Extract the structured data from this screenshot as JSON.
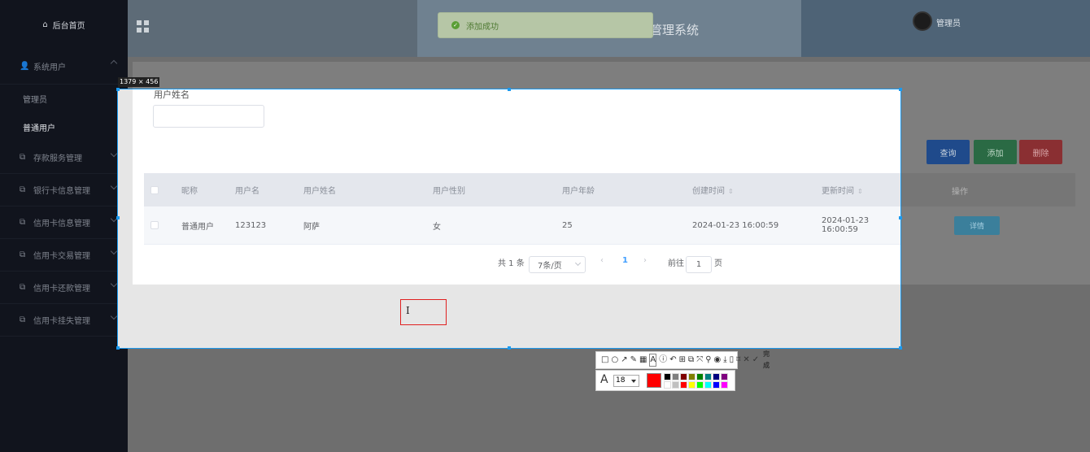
{
  "sidebar": {
    "brand": "后台首页",
    "groups": [
      {
        "label": "系统用户",
        "expanded": true
      },
      {
        "label": "存款服务管理"
      },
      {
        "label": "银行卡信息管理"
      },
      {
        "label": "信用卡信息管理"
      },
      {
        "label": "信用卡交易管理"
      },
      {
        "label": "信用卡还款管理"
      },
      {
        "label": "信用卡挂失管理"
      }
    ],
    "sub_items": [
      "管理员",
      "普通用户"
    ]
  },
  "header": {
    "title_fragment": "管理系统",
    "user": "管理员"
  },
  "toast": {
    "message": "添加成功",
    "color": "#5a9e35"
  },
  "search": {
    "label": "用户姓名",
    "value": ""
  },
  "actions": {
    "query": "查询",
    "add": "添加",
    "delete": "删除"
  },
  "table": {
    "columns": [
      "昵称",
      "用户名",
      "用户姓名",
      "用户性别",
      "用户年龄",
      "创建时间",
      "更新时间",
      "操作"
    ],
    "rows": [
      {
        "nickname": "普通用户",
        "username": "123123",
        "name": "阿萨",
        "gender": "女",
        "age": "25",
        "created": "2024-01-23 16:00:59",
        "updated": "2024-01-23 16:00:59",
        "action": "详情"
      }
    ]
  },
  "pagination": {
    "total": "共 1 条",
    "page_size": "7条/页",
    "current": "1",
    "goto_label": "前往",
    "goto_value": "1",
    "page_suffix": "页",
    "prev": "‹",
    "next": "›"
  },
  "screenshot_tool": {
    "dimensions": "1379 × 456",
    "font_size": "18",
    "done_label": "完成",
    "current_color": "#ff0000",
    "palette": [
      "#000000",
      "#808080",
      "#800000",
      "#808000",
      "#008000",
      "#008080",
      "#000080",
      "#800080",
      "#ffffff",
      "#c0c0c0",
      "#ff0000",
      "#ffff00",
      "#00ff00",
      "#00ffff",
      "#0000ff",
      "#ff00ff"
    ]
  }
}
